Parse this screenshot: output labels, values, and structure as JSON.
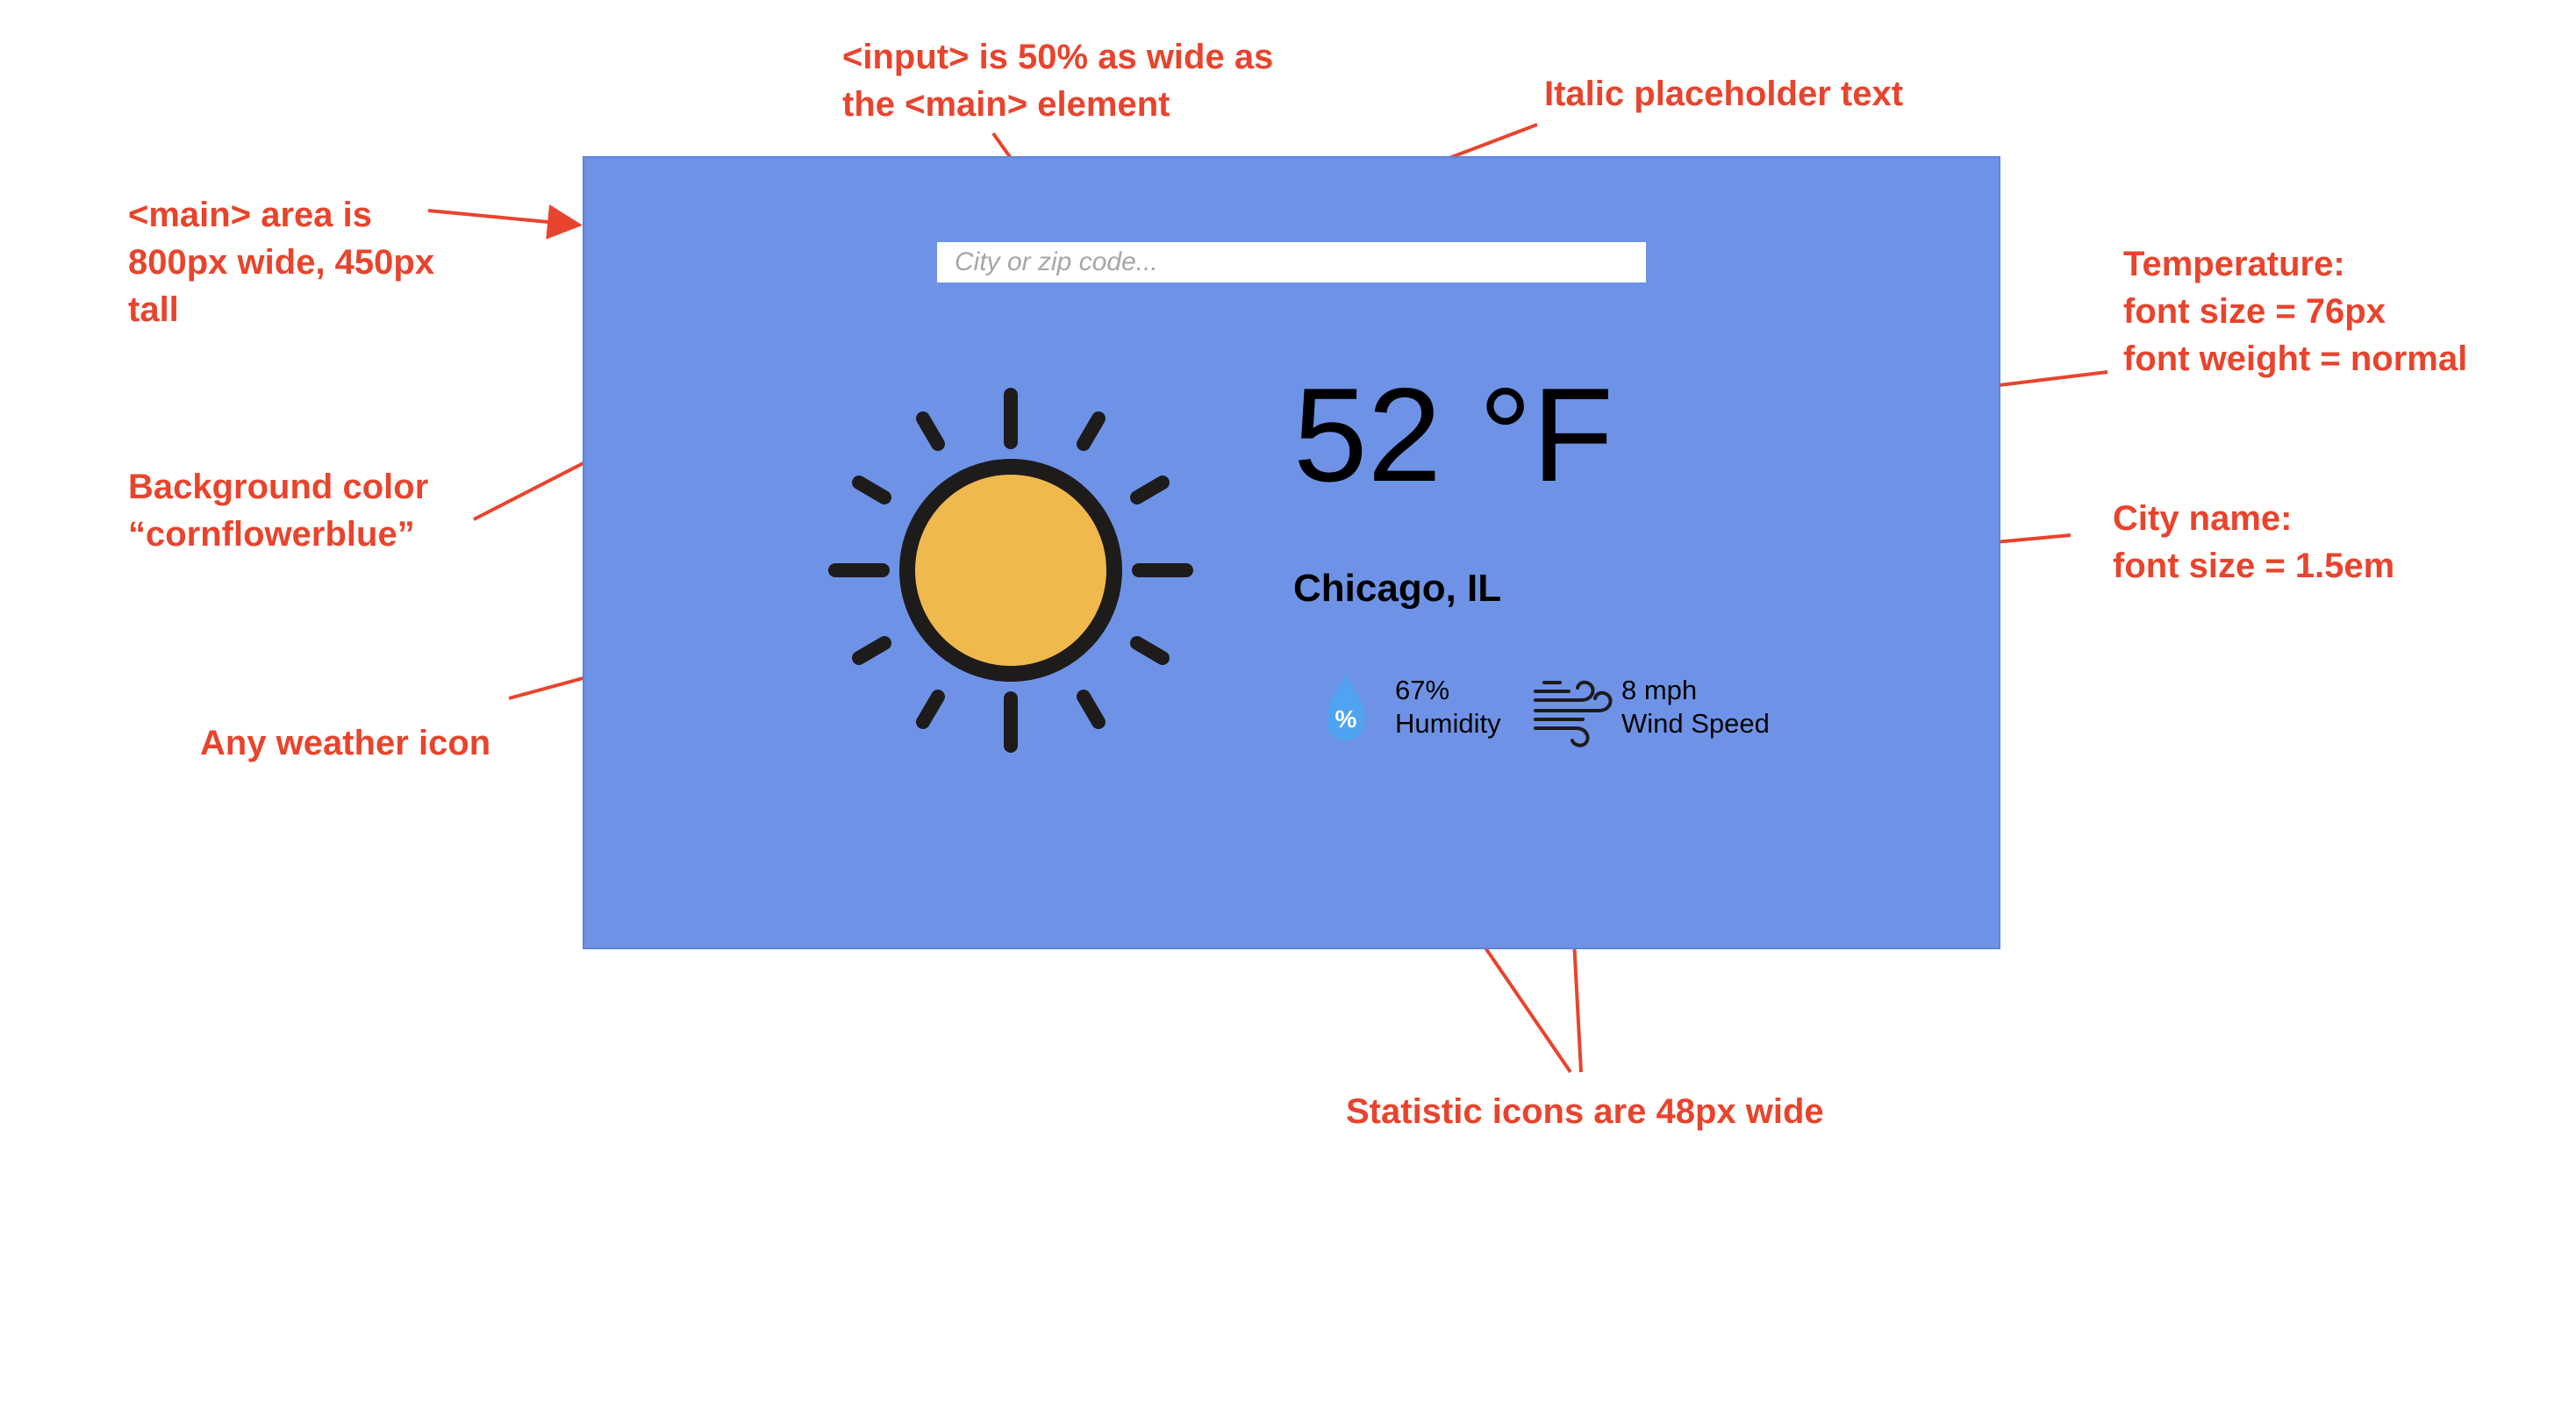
{
  "main": {
    "background_color": "#6e93e6",
    "search": {
      "placeholder": "City or zip code...",
      "value": ""
    },
    "weather_icon": "sun-icon",
    "temperature": "52 °F",
    "city": "Chicago, IL",
    "stats": {
      "humidity": {
        "icon": "humidity-drop-icon",
        "icon_label": "%",
        "value": "67%",
        "label": "Humidity"
      },
      "wind": {
        "icon": "wind-icon",
        "value": "8 mph",
        "label": "Wind Speed"
      }
    }
  },
  "annotations": {
    "input_width": [
      "<input> is 50% as wide as",
      "the <main> element"
    ],
    "placeholder": [
      "Italic placeholder text"
    ],
    "main_area": [
      "<main> area is",
      "800px wide, 450px",
      "tall"
    ],
    "background": [
      "Background color",
      "“cornflowerblue”"
    ],
    "weather_icon": [
      "Any weather icon"
    ],
    "temperature": [
      "Temperature:",
      "font size = 76px",
      "font weight = normal"
    ],
    "city": [
      "City name:",
      "font size = 1.5em"
    ],
    "stat_icons": [
      "Statistic icons are 48px wide"
    ]
  },
  "colors": {
    "annotation": "#e8442d",
    "sun_fill": "#efb94d",
    "sun_stroke": "#1e1b1b",
    "drop_fill": "#4fa3f0"
  }
}
